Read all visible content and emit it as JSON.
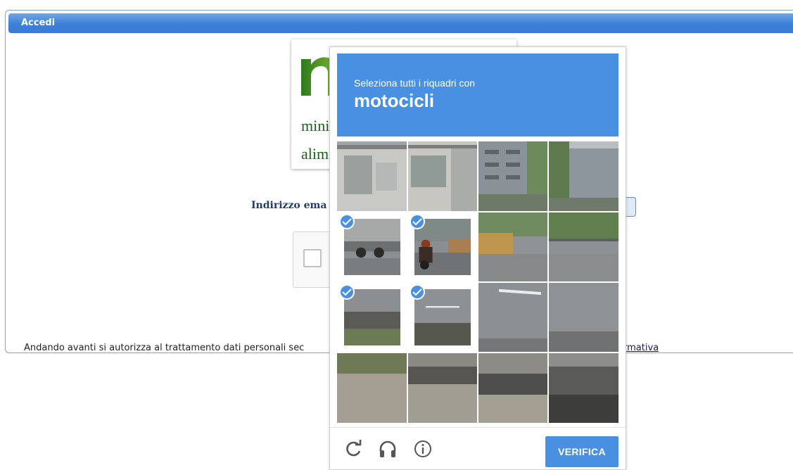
{
  "panel": {
    "title": "Accedi"
  },
  "logo": {
    "line1": "minis",
    "line2": "alime"
  },
  "form": {
    "email_label": "Indirizzo ema"
  },
  "footer": {
    "consent_text": "Andando avanti si autorizza al trattamento dati personali sec",
    "link_text": "rmativa"
  },
  "challenge": {
    "instruction": "Seleziona tutti i riquadri con",
    "object": "motocicli",
    "tiles": [
      {
        "row": 0,
        "col": 0,
        "selected": false
      },
      {
        "row": 0,
        "col": 1,
        "selected": false
      },
      {
        "row": 0,
        "col": 2,
        "selected": false
      },
      {
        "row": 0,
        "col": 3,
        "selected": false
      },
      {
        "row": 1,
        "col": 0,
        "selected": true
      },
      {
        "row": 1,
        "col": 1,
        "selected": true
      },
      {
        "row": 1,
        "col": 2,
        "selected": false
      },
      {
        "row": 1,
        "col": 3,
        "selected": false
      },
      {
        "row": 2,
        "col": 0,
        "selected": true
      },
      {
        "row": 2,
        "col": 1,
        "selected": true
      },
      {
        "row": 2,
        "col": 2,
        "selected": false
      },
      {
        "row": 2,
        "col": 3,
        "selected": false
      },
      {
        "row": 3,
        "col": 0,
        "selected": false
      },
      {
        "row": 3,
        "col": 1,
        "selected": false
      },
      {
        "row": 3,
        "col": 2,
        "selected": false
      },
      {
        "row": 3,
        "col": 3,
        "selected": false
      }
    ],
    "icons": [
      "reload-icon",
      "headphones-icon",
      "info-icon"
    ],
    "verify_label": "VERIFICA"
  },
  "colors": {
    "accent": "#4a90e2",
    "header": "#3d80d8",
    "logo_green": "#1f5e1f"
  }
}
